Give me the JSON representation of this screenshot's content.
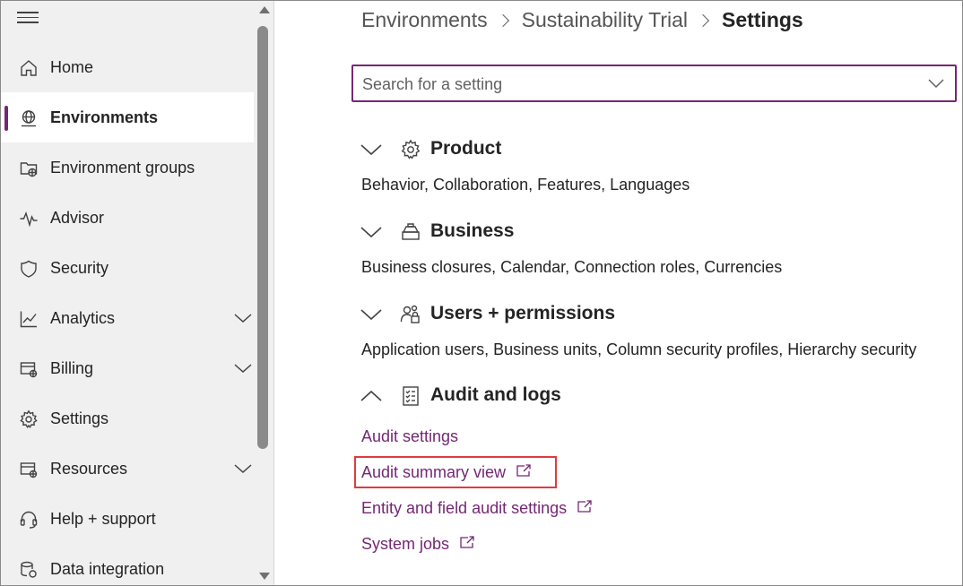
{
  "sidebar": {
    "items": [
      {
        "label": "Home",
        "icon": "home-icon"
      },
      {
        "label": "Environments",
        "icon": "globe-icon",
        "active": true
      },
      {
        "label": "Environment groups",
        "icon": "environment-groups-icon"
      },
      {
        "label": "Advisor",
        "icon": "pulse-icon"
      },
      {
        "label": "Security",
        "icon": "shield-icon"
      },
      {
        "label": "Analytics",
        "icon": "chart-line-icon",
        "expandable": true
      },
      {
        "label": "Billing",
        "icon": "billing-icon",
        "expandable": true
      },
      {
        "label": "Settings",
        "icon": "gear-icon"
      },
      {
        "label": "Resources",
        "icon": "resources-icon",
        "expandable": true
      },
      {
        "label": "Help + support",
        "icon": "headset-icon"
      },
      {
        "label": "Data integration",
        "icon": "data-integration-icon"
      }
    ]
  },
  "breadcrumb": {
    "items": [
      "Environments",
      "Sustainability Trial"
    ],
    "current": "Settings"
  },
  "search": {
    "placeholder": "Search for a setting"
  },
  "sections": [
    {
      "title": "Product",
      "description": "Behavior, Collaboration, Features, Languages",
      "expanded": false
    },
    {
      "title": "Business",
      "description": "Business closures, Calendar, Connection roles, Currencies",
      "expanded": false
    },
    {
      "title": "Users + permissions",
      "description": "Application users, Business units, Column security profiles, Hierarchy security",
      "expanded": false
    },
    {
      "title": "Audit and logs",
      "expanded": true,
      "links": [
        {
          "label": "Audit settings",
          "external": false
        },
        {
          "label": "Audit summary view",
          "external": true,
          "highlighted": true
        },
        {
          "label": "Entity and field audit settings",
          "external": true
        },
        {
          "label": "System jobs",
          "external": true
        }
      ]
    }
  ],
  "colors": {
    "accent": "#742774",
    "highlight_border": "#e03c3c",
    "sidebar_bg": "#f0f0f0"
  }
}
